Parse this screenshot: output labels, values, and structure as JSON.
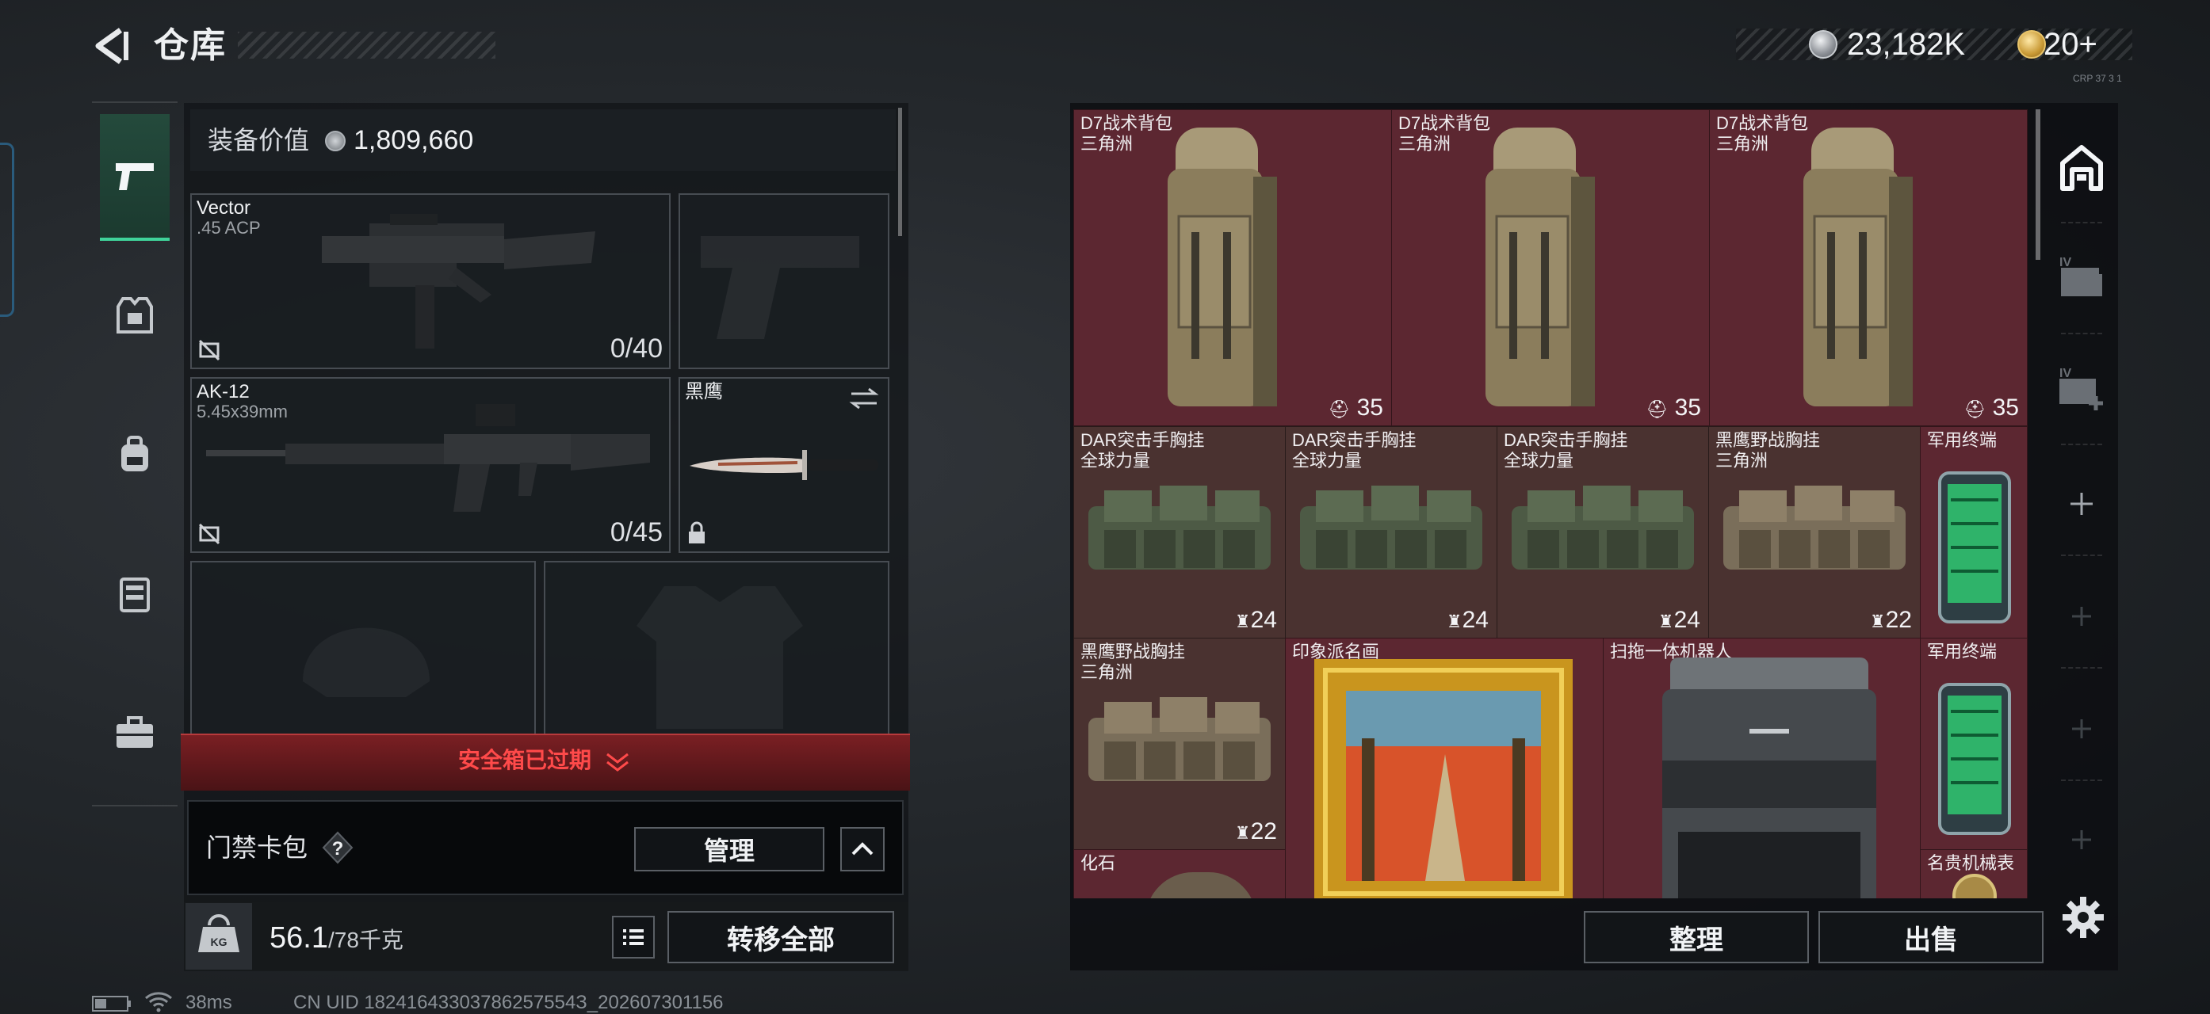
{
  "header": {
    "title": "仓库",
    "currency1": "23,182K",
    "currency2": "20+",
    "tiny_label": "CRP 37 3 1"
  },
  "equipment": {
    "value_label": "装备价值",
    "value": "1,809,660",
    "primary": {
      "name": "Vector",
      "caliber": ".45 ACP",
      "ammo": "0/40"
    },
    "secondary": {
      "name": "AK-12",
      "caliber": "5.45x39mm",
      "ammo": "0/45"
    },
    "melee": {
      "name": "黑鹰"
    }
  },
  "safebox": {
    "label": "安全箱已过期"
  },
  "keycard": {
    "label": "门禁卡包",
    "help": "?",
    "manage": "管理"
  },
  "weight": {
    "current": "56.1",
    "max": "/78千克",
    "transfer_all": "转移全部"
  },
  "status": {
    "ping": "38ms",
    "uid": "CN UID 18241643303786257554З_202607301156"
  },
  "storage": {
    "items": [
      {
        "name": "D7战术背包",
        "sub": "三角洲",
        "qty": "35"
      },
      {
        "name": "D7战术背包",
        "sub": "三角洲",
        "qty": "35"
      },
      {
        "name": "D7战术背包",
        "sub": "三角洲",
        "qty": "35"
      },
      {
        "name": "DAR突击手胸挂",
        "sub": "全球力量",
        "qty": "24"
      },
      {
        "name": "DAR突击手胸挂",
        "sub": "全球力量",
        "qty": "24"
      },
      {
        "name": "DAR突击手胸挂",
        "sub": "全球力量",
        "qty": "24"
      },
      {
        "name": "黑鹰野战胸挂",
        "sub": "三角洲",
        "qty": "22"
      },
      {
        "name": "军用终端",
        "sub": "",
        "qty": ""
      },
      {
        "name": "黑鹰野战胸挂",
        "sub": "三角洲",
        "qty": "22"
      },
      {
        "name": "印象派名画",
        "sub": "",
        "qty": ""
      },
      {
        "name": "扫拖一体机器人",
        "sub": "",
        "qty": ""
      },
      {
        "name": "军用终端",
        "sub": "",
        "qty": ""
      },
      {
        "name": "化石",
        "sub": "",
        "qty": ""
      },
      {
        "name": "名贵机械表",
        "sub": "",
        "qty": ""
      }
    ],
    "sort": "整理",
    "sell": "出售"
  },
  "colors": {
    "accent_green": "#3fd39a",
    "expired_red": "#ff4a4a",
    "grid_bg": "#5b2731"
  }
}
